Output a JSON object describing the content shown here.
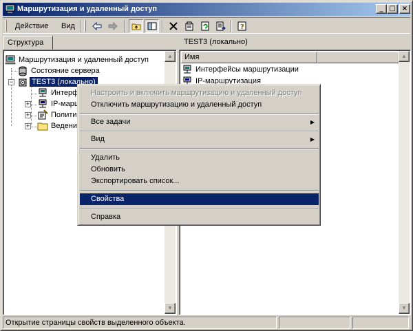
{
  "window": {
    "title": "Маршрутизация и удаленный доступ"
  },
  "controls": {
    "minimize": "_",
    "maximize": "□",
    "close": "×"
  },
  "menu": {
    "action": "Действие",
    "view": "Вид"
  },
  "toolbar_icons": [
    "back-icon",
    "forward-icon",
    "up-folder-icon",
    "show-tree-icon",
    "delete-icon",
    "properties-icon",
    "refresh-icon",
    "export-list-icon",
    "help-icon"
  ],
  "left_pane": {
    "tab": "Структура",
    "tree": [
      {
        "label": "Маршрутизация и удаленный доступ",
        "icon": "computer-icon"
      },
      {
        "label": "Состояние сервера",
        "icon": "server-status-icon"
      },
      {
        "label": "TEST3 (локально)",
        "icon": "server-icon"
      },
      {
        "label": "Интерфейсы маршрутизации",
        "icon": "interfaces-icon"
      },
      {
        "label": "IP-маршрутизация",
        "icon": "ip-routing-icon"
      },
      {
        "label": "Политика удаленного доступа",
        "icon": "policy-icon"
      },
      {
        "label": "Ведение журнала удаленного доступа",
        "icon": "folder-icon"
      }
    ]
  },
  "right_pane": {
    "header": "TEST3 (локально)",
    "column": "Имя",
    "items": [
      {
        "label": "Интерфейсы маршрутизации",
        "icon": "interfaces-icon"
      },
      {
        "label": "IP-маршрутизация",
        "icon": "ip-routing-icon"
      }
    ]
  },
  "context_menu": {
    "configure": "Настроить и включить маршрутизацию и удаленный доступ",
    "disable": "Отключить маршрутизацию и удаленный доступ",
    "all_tasks": "Все задачи",
    "view": "Вид",
    "delete": "Удалить",
    "refresh": "Обновить",
    "export": "Экспортировать список...",
    "properties": "Свойства",
    "help": "Справка"
  },
  "status_bar": {
    "text": "Открытие страницы свойств выделенного объекта."
  }
}
